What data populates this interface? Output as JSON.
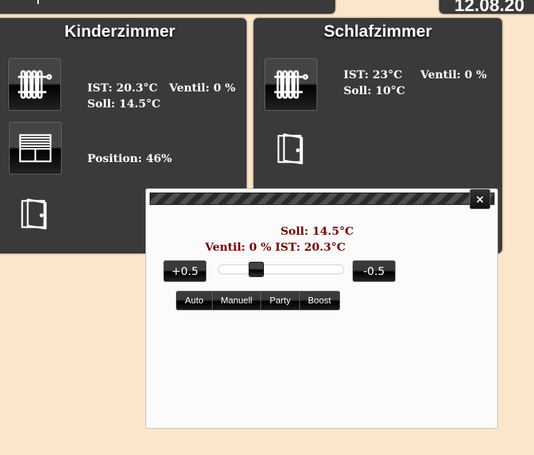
{
  "header": {
    "date": "12.08.20"
  },
  "rooms": [
    {
      "title": "Kinderzimmer",
      "ist": "IST: 20.3°C",
      "ventil": "Ventil: 0 %",
      "soll": "Soll: 14.5°C",
      "position": "Position: 46%"
    },
    {
      "title": "Schlafzimmer",
      "ist": "IST: 23°C",
      "ventil": "Ventil: 0 %",
      "soll": "Soll: 10°C"
    }
  ],
  "dialog": {
    "close_label": "×",
    "soll": "Soll: 14.5°C",
    "ventil": "Ventil: 0 %",
    "ist": "IST: 20.3°C",
    "plus_label": "+0.5",
    "minus_label": "-0.5",
    "slider_level": 0.3,
    "modes": [
      "Auto",
      "Manuell",
      "Party",
      "Boost"
    ]
  },
  "icons": {
    "radiator": "radiator-icon",
    "blinds": "window-blinds-icon",
    "door": "door-open-icon",
    "close": "close-icon"
  },
  "colors": {
    "page_background": "#fde7cc",
    "panel": "#3a3a3a",
    "dialog_text": "#7a0000"
  }
}
